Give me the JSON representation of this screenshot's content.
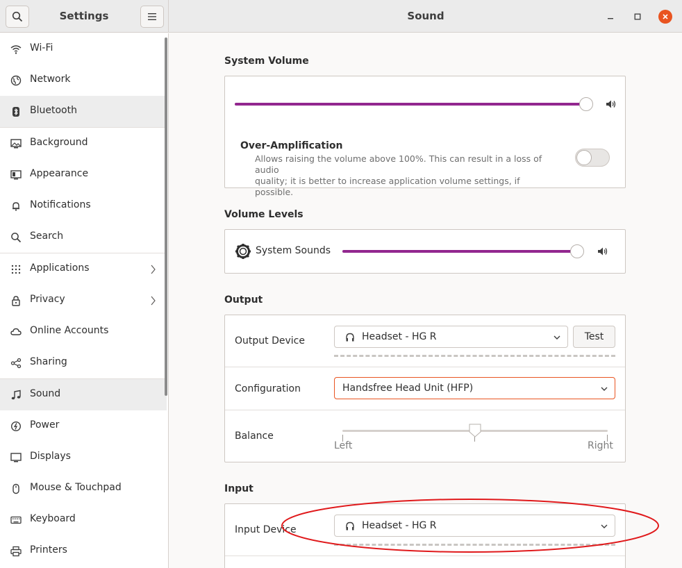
{
  "sidebar": {
    "title": "Settings",
    "items": [
      {
        "label": "Wi-Fi",
        "icon": "wifi-icon",
        "chevron": false
      },
      {
        "label": "Network",
        "icon": "network-icon",
        "chevron": false
      },
      {
        "label": "Bluetooth",
        "icon": "bluetooth-icon",
        "chevron": false
      },
      {
        "label": "Background",
        "icon": "background-icon",
        "chevron": false
      },
      {
        "label": "Appearance",
        "icon": "appearance-icon",
        "chevron": false
      },
      {
        "label": "Notifications",
        "icon": "bell-icon",
        "chevron": false
      },
      {
        "label": "Search",
        "icon": "search-icon",
        "chevron": false
      },
      {
        "label": "Applications",
        "icon": "apps-grid-icon",
        "chevron": true
      },
      {
        "label": "Privacy",
        "icon": "lock-icon",
        "chevron": true
      },
      {
        "label": "Online Accounts",
        "icon": "cloud-icon",
        "chevron": false
      },
      {
        "label": "Sharing",
        "icon": "share-icon",
        "chevron": false
      },
      {
        "label": "Sound",
        "icon": "music-note-icon",
        "chevron": false
      },
      {
        "label": "Power",
        "icon": "power-icon",
        "chevron": false
      },
      {
        "label": "Displays",
        "icon": "display-icon",
        "chevron": false
      },
      {
        "label": "Mouse & Touchpad",
        "icon": "mouse-icon",
        "chevron": false
      },
      {
        "label": "Keyboard",
        "icon": "keyboard-icon",
        "chevron": false
      },
      {
        "label": "Printers",
        "icon": "printer-icon",
        "chevron": false
      }
    ],
    "active_item": "Sound"
  },
  "window": {
    "title": "Sound",
    "close_color": "#e95420"
  },
  "system_volume": {
    "heading": "System Volume",
    "level": 1.0,
    "over_amplification": {
      "title": "Over-Amplification",
      "description_line1": "Allows raising the volume above 100%. This can result in a loss of audio",
      "description_line2": "quality; it is better to increase application volume settings, if possible.",
      "enabled": false
    }
  },
  "volume_levels": {
    "heading": "Volume Levels",
    "items": [
      {
        "label": "System Sounds",
        "level": 1.0
      }
    ]
  },
  "output": {
    "heading": "Output",
    "device_label": "Output Device",
    "device_value": "Headset - HG R",
    "test_label": "Test",
    "configuration_label": "Configuration",
    "configuration_value": "Handsfree Head Unit (HFP)",
    "balance_label": "Balance",
    "balance_left": "Left",
    "balance_right": "Right",
    "balance_value": 0.5
  },
  "input": {
    "heading": "Input",
    "device_label": "Input Device",
    "device_value": "Headset - HG R"
  },
  "colors": {
    "accent": "#92278f",
    "annotation": "#e0191b",
    "focus_border": "#e95420"
  }
}
